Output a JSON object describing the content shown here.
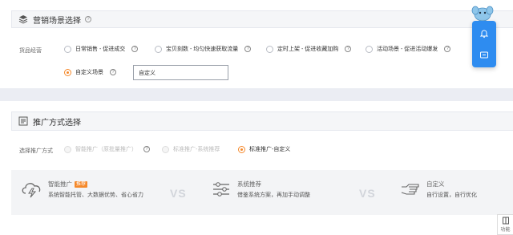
{
  "section1": {
    "title": "营销场景选择",
    "help": "?",
    "row_label": "货品经营",
    "options": [
      {
        "label": "日常销售 - 促进成交",
        "selected": false
      },
      {
        "label": "宝贝刻数 - 均匀快速获取流量",
        "selected": false
      },
      {
        "label": "定时上架 - 促进收藏加购",
        "selected": false
      },
      {
        "label": "活动场景 - 促进活动爆发",
        "selected": false
      },
      {
        "label": "自定义场景",
        "selected": true
      }
    ],
    "custom_input_value": "自定义"
  },
  "section2": {
    "title": "推广方式选择",
    "row_label": "选择推广方式",
    "options": [
      {
        "label": "智能推广（原批量推广）",
        "selected": false,
        "disabled": true
      },
      {
        "label": "标准推广-系统推荐",
        "selected": false,
        "disabled": true
      },
      {
        "label": "标准推广-自定义",
        "selected": true,
        "disabled": false
      }
    ],
    "compare": [
      {
        "title": "智能推广",
        "badge": "推荐",
        "desc": "系统智能托管、大数据优势、省心省力",
        "icon": "cloud-bolt-icon"
      },
      {
        "title": "系统推荐",
        "badge": "",
        "desc": "借鉴系统方案，再加手动调整",
        "icon": "sliders-icon"
      },
      {
        "title": "自定义",
        "badge": "",
        "desc": "自行设置，自行优化",
        "icon": "hand-point-icon"
      }
    ],
    "vs_label": "VS"
  },
  "float": {
    "bell_icon": "bell-icon",
    "chat_icon": "chat-icon"
  },
  "func_label": "功能",
  "colors": {
    "accent": "#f5892b",
    "float_blue": "#2e8cf0",
    "background": "#ebedf3"
  }
}
